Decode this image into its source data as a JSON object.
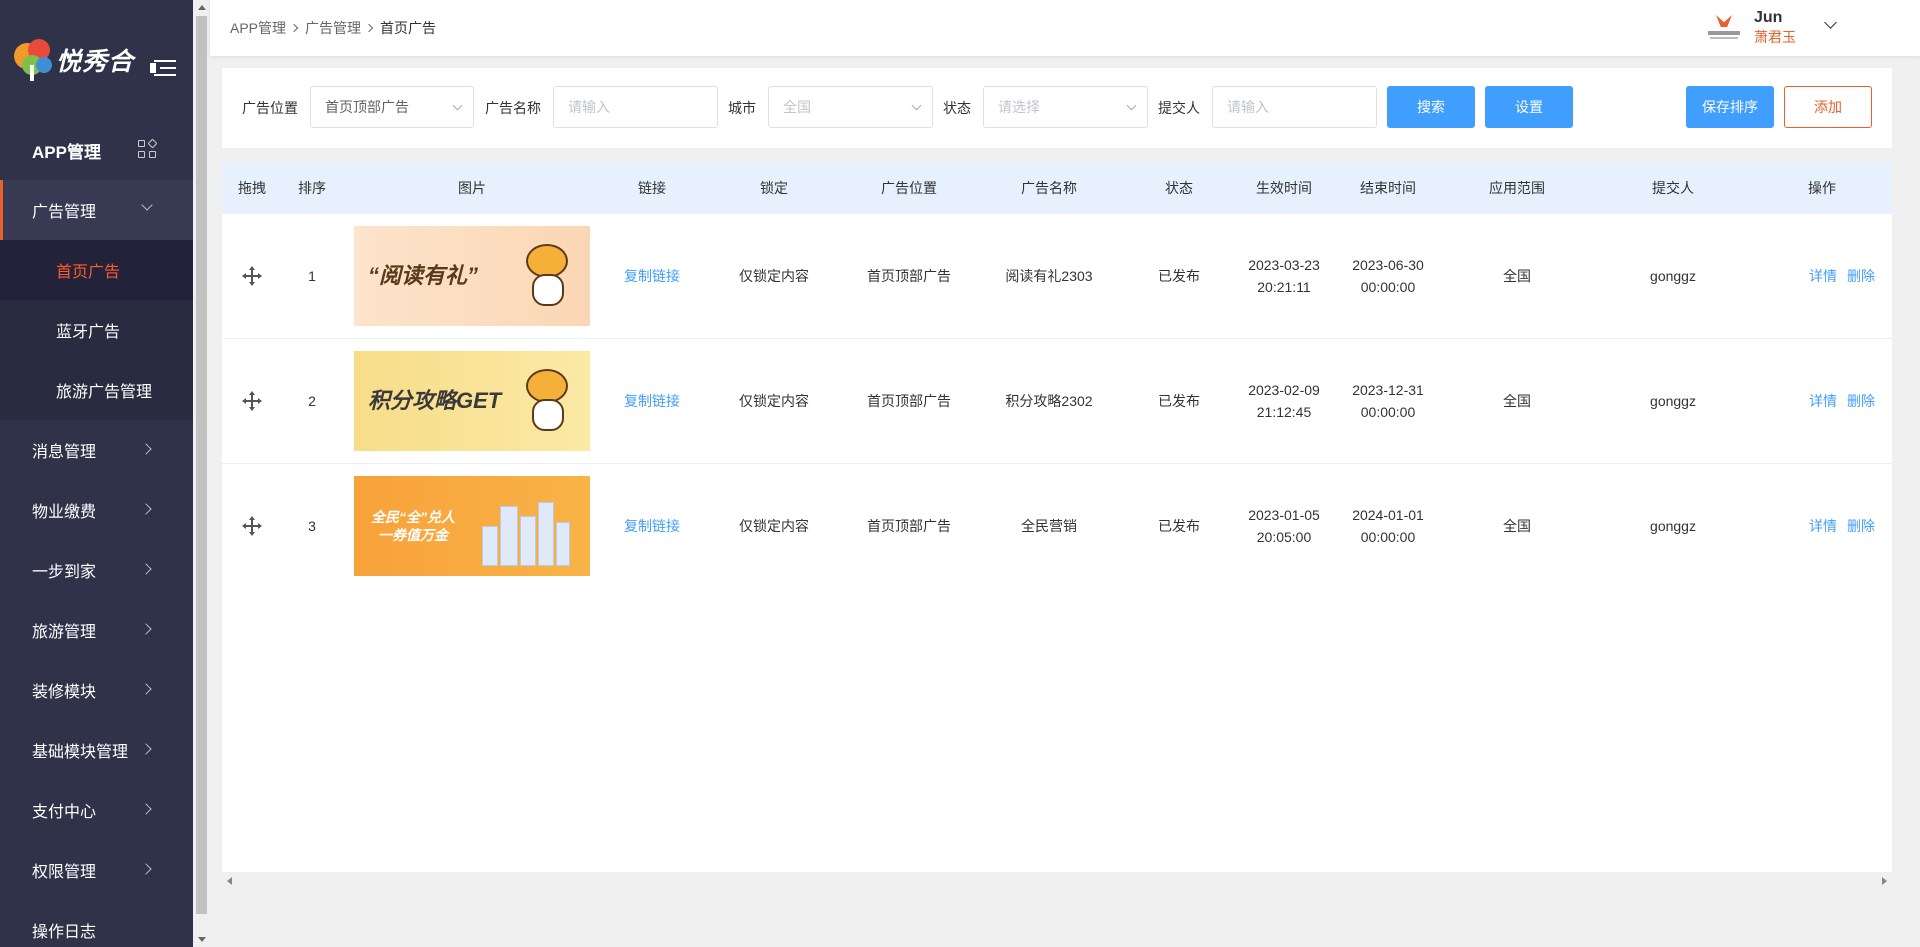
{
  "brand": {
    "name": "悦秀合"
  },
  "sidebar": {
    "app_menu": "APP管理",
    "open_menu": "广告管理",
    "submenu": [
      "首页广告",
      "蓝牙广告",
      "旅游广告管理"
    ],
    "items": [
      "消息管理",
      "物业缴费",
      "一步到家",
      "旅游管理",
      "装修模块",
      "基础模块管理",
      "支付中心",
      "权限管理",
      "操作日志"
    ]
  },
  "breadcrumb": [
    "APP管理",
    "广告管理",
    "首页广告"
  ],
  "user": {
    "name": "Jun",
    "subname": "萧君玉"
  },
  "filter": {
    "position_label": "广告位置",
    "position_value": "首页顶部广告",
    "name_label": "广告名称",
    "name_placeholder": "请输入",
    "city_label": "城市",
    "city_placeholder": "全国",
    "status_label": "状态",
    "status_placeholder": "请选择",
    "submitter_label": "提交人",
    "submitter_placeholder": "请输入",
    "search_btn": "搜索",
    "settings_btn": "设置",
    "save_order_btn": "保存排序",
    "add_btn": "添加"
  },
  "table": {
    "headers": [
      "拖拽",
      "排序",
      "图片",
      "链接",
      "锁定",
      "广告位置",
      "广告名称",
      "状态",
      "生效时间",
      "结束时间",
      "应用范围",
      "提交人",
      "操作"
    ],
    "rows": [
      {
        "order": "1",
        "banner_title": "“阅读有礼”",
        "link": "复制链接",
        "lock": "仅锁定内容",
        "position": "首页顶部广告",
        "name": "阅读有礼2303",
        "status": "已发布",
        "start_date": "2023-03-23",
        "start_time": "20:21:11",
        "end_date": "2023-06-30",
        "end_time": "00:00:00",
        "scope": "全国",
        "submitter": "gonggz",
        "detail": "详情",
        "delete": "删除"
      },
      {
        "order": "2",
        "banner_title": "积分攻略GET",
        "link": "复制链接",
        "lock": "仅锁定内容",
        "position": "首页顶部广告",
        "name": "积分攻略2302",
        "status": "已发布",
        "start_date": "2023-02-09",
        "start_time": "21:12:45",
        "end_date": "2023-12-31",
        "end_time": "00:00:00",
        "scope": "全国",
        "submitter": "gonggz",
        "detail": "详情",
        "delete": "删除"
      },
      {
        "order": "3",
        "banner_title": "全民“全”兑人 一券值万金",
        "link": "复制链接",
        "lock": "仅锁定内容",
        "position": "首页顶部广告",
        "name": "全民营销",
        "status": "已发布",
        "start_date": "2023-01-05",
        "start_time": "20:05:00",
        "end_date": "2024-01-01",
        "end_time": "00:00:00",
        "scope": "全国",
        "submitter": "gonggz",
        "detail": "详情",
        "delete": "删除"
      }
    ]
  }
}
